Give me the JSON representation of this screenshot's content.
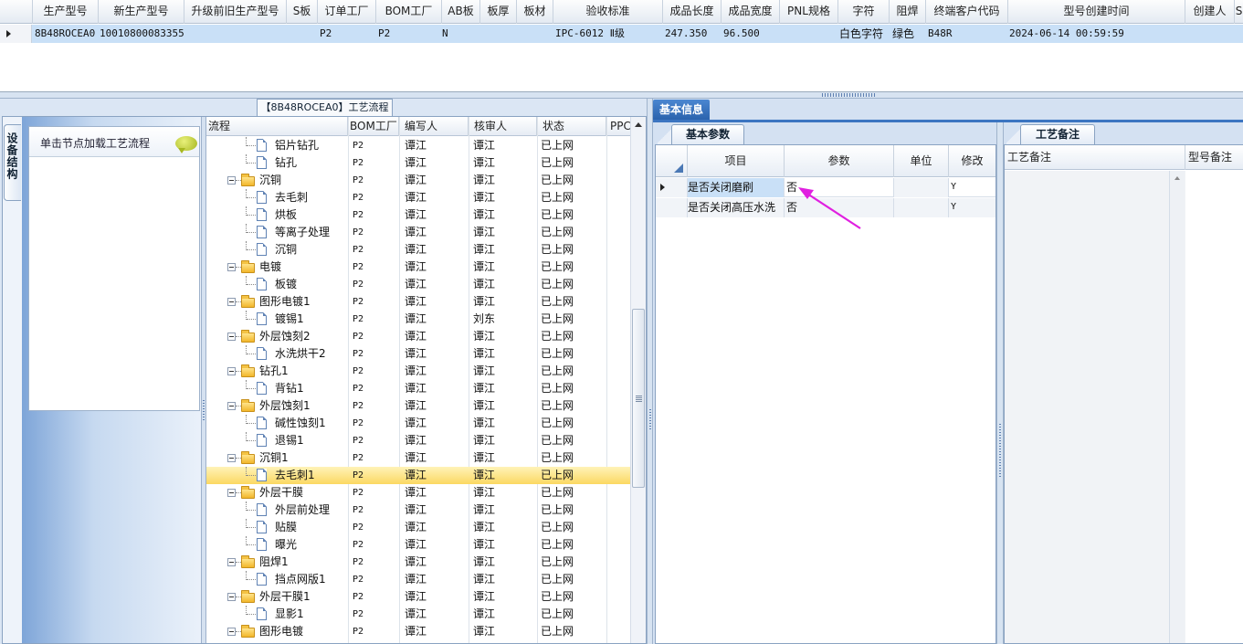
{
  "top_grid": {
    "columns": [
      "生产型号",
      "新生产型号",
      "升级前旧生产型号",
      "S板",
      "订单工厂",
      "BOM工厂",
      "AB板",
      "板厚",
      "板材",
      "验收标准",
      "成品长度",
      "成品宽度",
      "PNL规格",
      "字符",
      "阻焊",
      "终端客户代码",
      "型号创建时间",
      "创建人",
      "S"
    ],
    "row": {
      "prod_model": "8B48ROCEA0",
      "new_prod_model": "10010800083355",
      "old_prod_model": "",
      "s_board": "",
      "order_factory": "P2",
      "bom_factory": "P2",
      "ab_board": "N",
      "thickness": "",
      "material": "",
      "acceptance": "IPC-6012 Ⅱ级",
      "length": "247.350",
      "width": "96.500",
      "pnl": "",
      "char": "白色字符",
      "solder": "绿色",
      "customer_code": "B48R",
      "created_time": "2024-06-14 00:59:59",
      "creator": ""
    }
  },
  "left_panel": {
    "caption": "【8B48ROCEA0】工艺流程",
    "vertical_tab": "设备结构",
    "equip_hint": "单击节点加载工艺流程"
  },
  "tree": {
    "columns": [
      "流程",
      "BOM工厂",
      "编写人",
      "核审人",
      "状态",
      "PPC"
    ],
    "rows": [
      {
        "name": "铝片钻孔",
        "type": "doc",
        "factory": "P2",
        "writer": "谭江",
        "reviewer": "谭江",
        "status": "已上网"
      },
      {
        "name": "钻孔",
        "type": "doc",
        "factory": "P2",
        "writer": "谭江",
        "reviewer": "谭江",
        "status": "已上网"
      },
      {
        "name": "沉铜",
        "type": "folder",
        "factory": "P2",
        "writer": "谭江",
        "reviewer": "谭江",
        "status": "已上网"
      },
      {
        "name": "去毛刺",
        "type": "doc",
        "factory": "P2",
        "writer": "谭江",
        "reviewer": "谭江",
        "status": "已上网"
      },
      {
        "name": "烘板",
        "type": "doc",
        "factory": "P2",
        "writer": "谭江",
        "reviewer": "谭江",
        "status": "已上网"
      },
      {
        "name": "等离子处理",
        "type": "doc",
        "factory": "P2",
        "writer": "谭江",
        "reviewer": "谭江",
        "status": "已上网"
      },
      {
        "name": "沉铜",
        "type": "doc",
        "factory": "P2",
        "writer": "谭江",
        "reviewer": "谭江",
        "status": "已上网"
      },
      {
        "name": "电镀",
        "type": "folder",
        "factory": "P2",
        "writer": "谭江",
        "reviewer": "谭江",
        "status": "已上网"
      },
      {
        "name": "板镀",
        "type": "doc",
        "factory": "P2",
        "writer": "谭江",
        "reviewer": "谭江",
        "status": "已上网"
      },
      {
        "name": "图形电镀1",
        "type": "folder",
        "factory": "P2",
        "writer": "谭江",
        "reviewer": "谭江",
        "status": "已上网"
      },
      {
        "name": "镀锡1",
        "type": "doc",
        "factory": "P2",
        "writer": "谭江",
        "reviewer": "刘东",
        "status": "已上网"
      },
      {
        "name": "外层蚀刻2",
        "type": "folder",
        "factory": "P2",
        "writer": "谭江",
        "reviewer": "谭江",
        "status": "已上网"
      },
      {
        "name": "水洗烘干2",
        "type": "doc",
        "factory": "P2",
        "writer": "谭江",
        "reviewer": "谭江",
        "status": "已上网"
      },
      {
        "name": "钻孔1",
        "type": "folder",
        "factory": "P2",
        "writer": "谭江",
        "reviewer": "谭江",
        "status": "已上网"
      },
      {
        "name": "背钻1",
        "type": "doc",
        "factory": "P2",
        "writer": "谭江",
        "reviewer": "谭江",
        "status": "已上网"
      },
      {
        "name": "外层蚀刻1",
        "type": "folder",
        "factory": "P2",
        "writer": "谭江",
        "reviewer": "谭江",
        "status": "已上网"
      },
      {
        "name": "碱性蚀刻1",
        "type": "doc",
        "factory": "P2",
        "writer": "谭江",
        "reviewer": "谭江",
        "status": "已上网"
      },
      {
        "name": "退锡1",
        "type": "doc",
        "factory": "P2",
        "writer": "谭江",
        "reviewer": "谭江",
        "status": "已上网"
      },
      {
        "name": "沉铜1",
        "type": "folder",
        "factory": "P2",
        "writer": "谭江",
        "reviewer": "谭江",
        "status": "已上网"
      },
      {
        "name": "去毛刺1",
        "type": "doc",
        "factory": "P2",
        "writer": "谭江",
        "reviewer": "谭江",
        "status": "已上网",
        "selected": true
      },
      {
        "name": "外层干膜",
        "type": "folder",
        "factory": "P2",
        "writer": "谭江",
        "reviewer": "谭江",
        "status": "已上网"
      },
      {
        "name": "外层前处理",
        "type": "doc",
        "factory": "P2",
        "writer": "谭江",
        "reviewer": "谭江",
        "status": "已上网"
      },
      {
        "name": "贴膜",
        "type": "doc",
        "factory": "P2",
        "writer": "谭江",
        "reviewer": "谭江",
        "status": "已上网"
      },
      {
        "name": "曝光",
        "type": "doc",
        "factory": "P2",
        "writer": "谭江",
        "reviewer": "谭江",
        "status": "已上网"
      },
      {
        "name": "阻焊1",
        "type": "folder",
        "factory": "P2",
        "writer": "谭江",
        "reviewer": "谭江",
        "status": "已上网"
      },
      {
        "name": "挡点网版1",
        "type": "doc",
        "factory": "P2",
        "writer": "谭江",
        "reviewer": "谭江",
        "status": "已上网"
      },
      {
        "name": "外层干膜1",
        "type": "folder",
        "factory": "P2",
        "writer": "谭江",
        "reviewer": "谭江",
        "status": "已上网"
      },
      {
        "name": "显影1",
        "type": "doc",
        "factory": "P2",
        "writer": "谭江",
        "reviewer": "谭江",
        "status": "已上网"
      },
      {
        "name": "图形电镀",
        "type": "folder",
        "factory": "P2",
        "writer": "谭江",
        "reviewer": "谭江",
        "status": "已上网"
      }
    ]
  },
  "right_panel": {
    "basic_info_tab": "基本信息",
    "basic_params_tab": "基本参数",
    "params_columns": [
      "项目",
      "参数",
      "单位",
      "修改"
    ],
    "params_rows": [
      {
        "item": "是否关闭磨刷",
        "param": "否",
        "unit": "",
        "modify": "Y"
      },
      {
        "item": "是否关闭高压水洗",
        "param": "否",
        "unit": "",
        "modify": "Y"
      }
    ],
    "notes_tab": "工艺备注",
    "notes_columns": [
      "工艺备注",
      "型号备注"
    ]
  },
  "colors": {
    "selection_blue": "#c9e0f7",
    "tree_selected": "#fbd862",
    "tab_active": "#2b63ad",
    "annotation_arrow": "#e020e0"
  }
}
